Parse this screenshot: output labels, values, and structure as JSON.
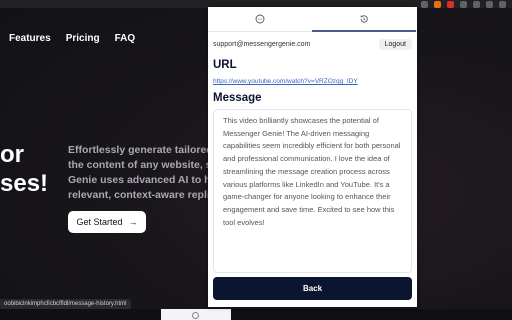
{
  "background_page": {
    "nav": [
      "Features",
      "Pricing",
      "FAQ"
    ],
    "hero_big_lines": [
      "or",
      "ses!"
    ],
    "hero_text_lines": [
      "Effortlessly generate tailored co",
      "the content of any website, soci",
      "Genie uses advanced AI to help",
      "relevant, context-aware replies"
    ],
    "cta_label": "Get Started",
    "cta_icon": "arrow-right-icon",
    "status_url": "oobibiclnkimphcficbcffldl/message-history.html"
  },
  "popup": {
    "tabs": [
      {
        "icon": "chat-bubble-icon",
        "active": false
      },
      {
        "icon": "history-clock-icon",
        "active": true
      }
    ],
    "user_email": "support@messengergenie.com",
    "logout_label": "Logout",
    "url_heading": "URL",
    "url_value": "https://www.youtube.com/watch?v=VRZOzqg_IDY",
    "message_heading": "Message",
    "message_text": "This video brilliantly showcases the potential of Messenger Genie! The AI-driven messaging capabilities seem incredibly efficient for both personal and professional communication. I love the idea of streamlining the message creation process across various platforms like LinkedIn and YouTube. It's a game-changer for anyone looking to enhance their engagement and save time. Excited to see how this tool evolves!",
    "back_label": "Back"
  },
  "colors": {
    "accent_dark": "#0b1530",
    "link": "#3a62c4",
    "page_bg": "#14141a"
  }
}
